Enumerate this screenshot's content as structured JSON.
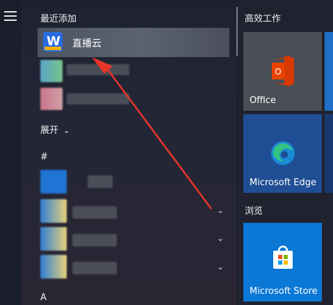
{
  "start_menu": {
    "recent_header": "最近添加",
    "recent_app_name": "直播云",
    "expand_label": "展开",
    "hash_header": "#",
    "a_header": "A",
    "group_productivity": "高效工作",
    "group_browse": "浏览",
    "tiles": {
      "office": "Office",
      "edge": "Microsoft Edge",
      "store": "Microsoft Store"
    }
  },
  "colors": {
    "annotation_arrow": "#e8352a",
    "tile_blue": "#1f6fc6",
    "store_blue": "#0b78d6"
  }
}
